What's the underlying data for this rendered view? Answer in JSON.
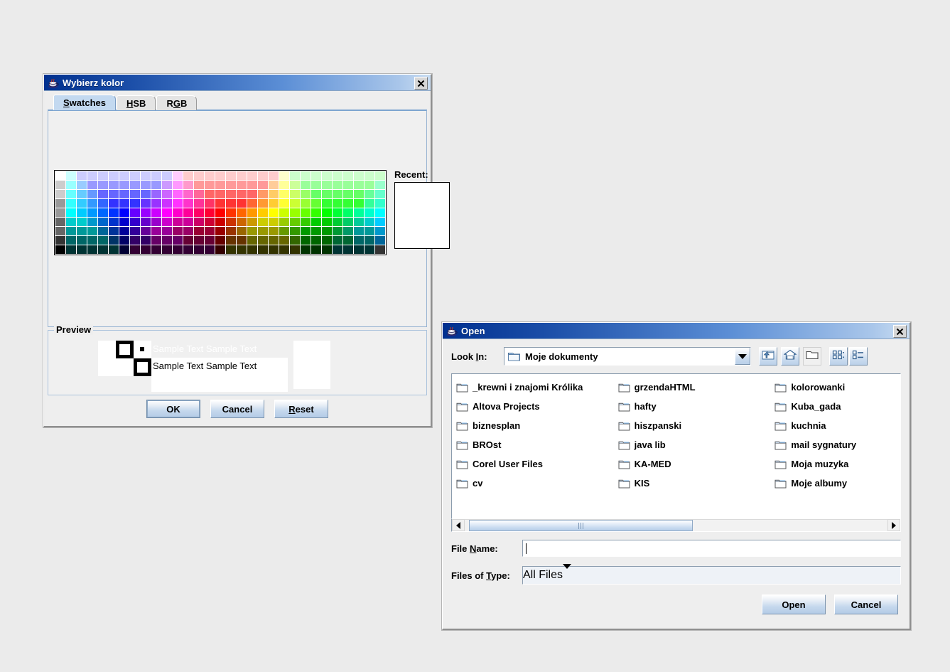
{
  "colors": {
    "titlebar_start": "#00308f",
    "titlebar_end": "#c9ddf2",
    "window_bg": "#eeeeee",
    "desktop_bg": "#ebebeb",
    "tab_selected": "#c3d9f0",
    "button_face": "#c5d8ed"
  },
  "color_chooser": {
    "title": "Wybierz kolor",
    "java_icon": "java-cup-icon",
    "close_label": "✕",
    "tabs": [
      {
        "label": "Swatches",
        "mnemonic": "S",
        "selected": true
      },
      {
        "label": "HSB",
        "mnemonic": "H",
        "selected": false
      },
      {
        "label": "RGB",
        "mnemonic": "G",
        "selected": false
      }
    ],
    "swatches": {
      "columns": 31,
      "rows": 9,
      "recent_label": "Recent:",
      "recent_columns": 5,
      "recent_rows": 7,
      "recent_colors": []
    },
    "preview": {
      "legend": "Preview",
      "sample_line_1": "Sample Text  Sample Text",
      "sample_line_2": "Sample Text  Sample Text",
      "selected_color": "#ffffff"
    },
    "buttons": [
      {
        "label": "OK",
        "mnemonic": "",
        "focused": true
      },
      {
        "label": "Cancel",
        "mnemonic": "",
        "focused": false
      },
      {
        "label": "Reset",
        "mnemonic": "R",
        "focused": false
      }
    ]
  },
  "open_dialog": {
    "title": "Open",
    "java_icon": "java-cup-icon",
    "close_label": "✕",
    "look_in": {
      "label": "Look In:",
      "mnemonic": "I",
      "value": "Moje dokumenty",
      "icon": "folder-icon"
    },
    "toolbar": [
      {
        "name": "up-one-level-button",
        "icon": "folder-up-icon"
      },
      {
        "name": "home-button",
        "icon": "home-icon"
      },
      {
        "name": "new-folder-button",
        "icon": "new-folder-icon"
      },
      {
        "name": "list-view-button",
        "icon": "list-view-icon"
      },
      {
        "name": "details-view-button",
        "icon": "details-view-icon"
      }
    ],
    "files": {
      "column1": [
        "_krewni i znajomi Królika",
        "Altova Projects",
        "biznesplan",
        "BROst",
        "Corel User Files",
        "cv"
      ],
      "column2": [
        "grzendaHTML",
        "hafty",
        "hiszpanski",
        "java lib",
        "KA-MED",
        "KIS"
      ],
      "column3": [
        "kolorowanki",
        "Kuba_gada",
        "kuchnia",
        "mail sygnatury",
        "Moja muzyka",
        "Moje albumy"
      ]
    },
    "scrollbar": {
      "thumb_left_pct": 1,
      "thumb_width_pct": 53
    },
    "file_name": {
      "label": "File Name:",
      "mnemonic": "N",
      "value": "",
      "placeholder": ""
    },
    "files_of_type": {
      "label": "Files of Type:",
      "mnemonic": "T",
      "value": "All Files",
      "options": [
        "All Files"
      ]
    },
    "buttons": [
      {
        "label": "Open"
      },
      {
        "label": "Cancel"
      }
    ]
  }
}
